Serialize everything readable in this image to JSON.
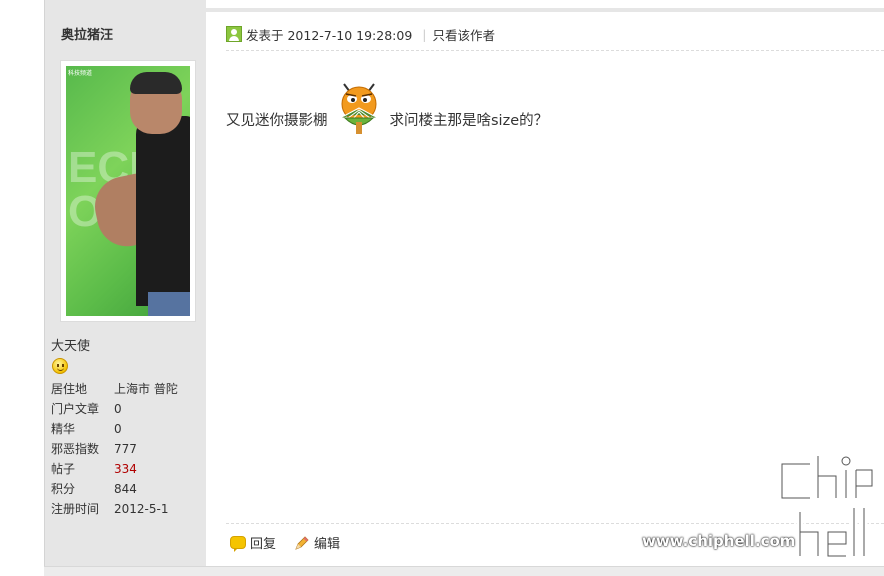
{
  "author": {
    "name": "奥拉猪汪",
    "avatar_caption": "科技频道",
    "avatar_backdrop_text": "ECH\nONI",
    "group": "大天使",
    "stats": [
      {
        "label": "居住地",
        "value": "上海市 普陀",
        "color": "#333333"
      },
      {
        "label": "门户文章",
        "value": "0",
        "color": "#333333"
      },
      {
        "label": "精华",
        "value": "0",
        "color": "#333333"
      },
      {
        "label": "邪恶指数",
        "value": "777",
        "color": "#333333"
      },
      {
        "label": "帖子",
        "value": "334",
        "color": "#b00000"
      },
      {
        "label": "积分",
        "value": "844",
        "color": "#333333"
      },
      {
        "label": "注册时间",
        "value": "2012-5-1",
        "color": "#333333"
      }
    ]
  },
  "post": {
    "posted_at": "发表于 2012-7-10 19:28:09",
    "only_author_link": "只看该作者",
    "message_before": "又见迷你摄影棚",
    "message_after": "求问楼主那是啥size的？",
    "emoticon": "smiley-fan-emoticon"
  },
  "actions": {
    "reply": "回复",
    "edit": "编辑"
  },
  "watermark": {
    "site": "www.chiphell.com",
    "logo_text": "chip hell"
  },
  "colors": {
    "sidebar_bg": "#e6e6e6",
    "online_green": "#8cc63f",
    "highlight_red": "#b00000"
  }
}
